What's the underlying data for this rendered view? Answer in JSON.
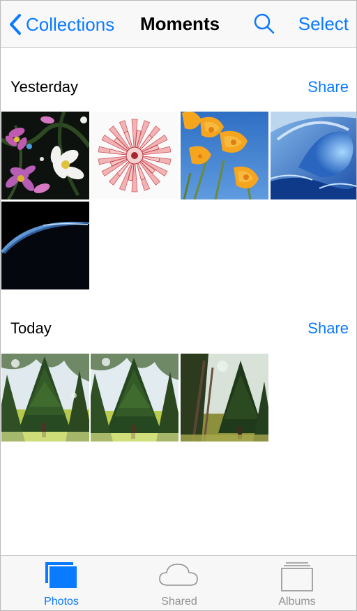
{
  "nav": {
    "back_label": "Collections",
    "title": "Moments",
    "select_label": "Select"
  },
  "sections": [
    {
      "title": "Yesterday",
      "share_label": "Share",
      "photos": [
        "pink-cosmos-flowers",
        "pink-dahlia",
        "orange-poppies",
        "ocean-wave",
        "earth-horizon"
      ]
    },
    {
      "title": "Today",
      "share_label": "Share",
      "photos": [
        "pine-tree-1",
        "pine-tree-2",
        "pine-tree-3"
      ]
    }
  ],
  "tabs": [
    {
      "label": "Photos",
      "icon": "photos-icon",
      "active": true
    },
    {
      "label": "Shared",
      "icon": "cloud-icon",
      "active": false
    },
    {
      "label": "Albums",
      "icon": "albums-icon",
      "active": false
    }
  ],
  "colors": {
    "accent": "#0a7aff",
    "inactive": "#929292"
  }
}
